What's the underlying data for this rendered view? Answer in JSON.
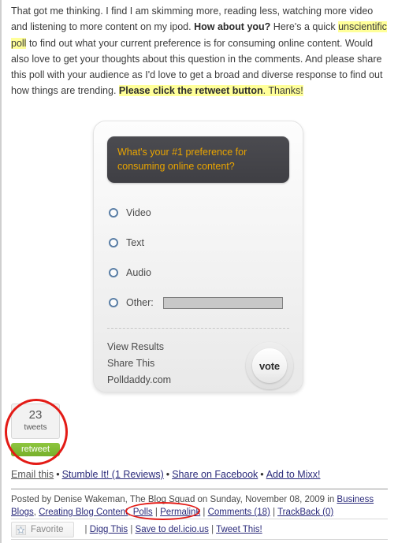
{
  "post": {
    "paragraph": {
      "seg1": "That got me thinking. I find I am skimming more, reading less, watching more video and listening to more content on my ipod. ",
      "bold1": "How about you?",
      "seg2": " Here's a quick ",
      "link_unscientific_poll": "unscientific poll",
      "seg3": " to find out what your current preference is for consuming online content. Would also love to get your thoughts about this question in the comments. And please share this poll with your audience as I'd love to get a broad and diverse response to find out how things are trending. ",
      "bold2": "Please click the retweet button",
      "seg4": ". Thanks!"
    }
  },
  "poll": {
    "question": "What's your #1 preference for consuming online content?",
    "options": [
      {
        "label": "Video",
        "type": "radio"
      },
      {
        "label": "Text",
        "type": "radio"
      },
      {
        "label": "Audio",
        "type": "radio"
      },
      {
        "label": "Other:",
        "type": "radio-with-text"
      }
    ],
    "other_value": "",
    "other_placeholder": "",
    "links": [
      "View Results",
      "Share This",
      "Polldaddy.com"
    ],
    "vote_label": "vote",
    "colors": {
      "question_bg": "#46464b",
      "question_text": "#e9a400",
      "card_bg": "#f2f2f2",
      "radio_ring": "#5b7fa6"
    }
  },
  "retweet": {
    "count": "23",
    "count_word": "tweets",
    "button_label": "retweet",
    "button_color": "#8ec63f"
  },
  "annotations": {
    "highlight_color": "#ffff99",
    "circle_color": "#e31b16"
  },
  "share": {
    "items": [
      {
        "label": "Email this",
        "muted": true
      },
      {
        "label": "Stumble It! (1 Reviews)",
        "muted": false
      },
      {
        "label": "Share on Facebook",
        "muted": false
      },
      {
        "label": "Add to Mixx!",
        "muted": false
      }
    ],
    "separator": "•"
  },
  "meta": {
    "posted_by_prefix": "Posted by ",
    "author": "Denise Wakeman, The Blog Squad",
    "on_word": " on ",
    "date": "Sunday, November 08, 2009",
    "in_word": " in ",
    "categories": [
      "Business Blogs",
      "Creating Blog Content",
      "Polls"
    ],
    "permalink": "Permalink",
    "comments": "Comments (18)",
    "trackback": "TrackBack (0)",
    "pipe": "|",
    "comma": ", "
  },
  "toolbar": {
    "favorite_label": "Favorite",
    "star_icon": "star-icon",
    "pipe": "|",
    "links": [
      "Digg This",
      "Save to del.icio.us",
      "Tweet This!"
    ]
  }
}
